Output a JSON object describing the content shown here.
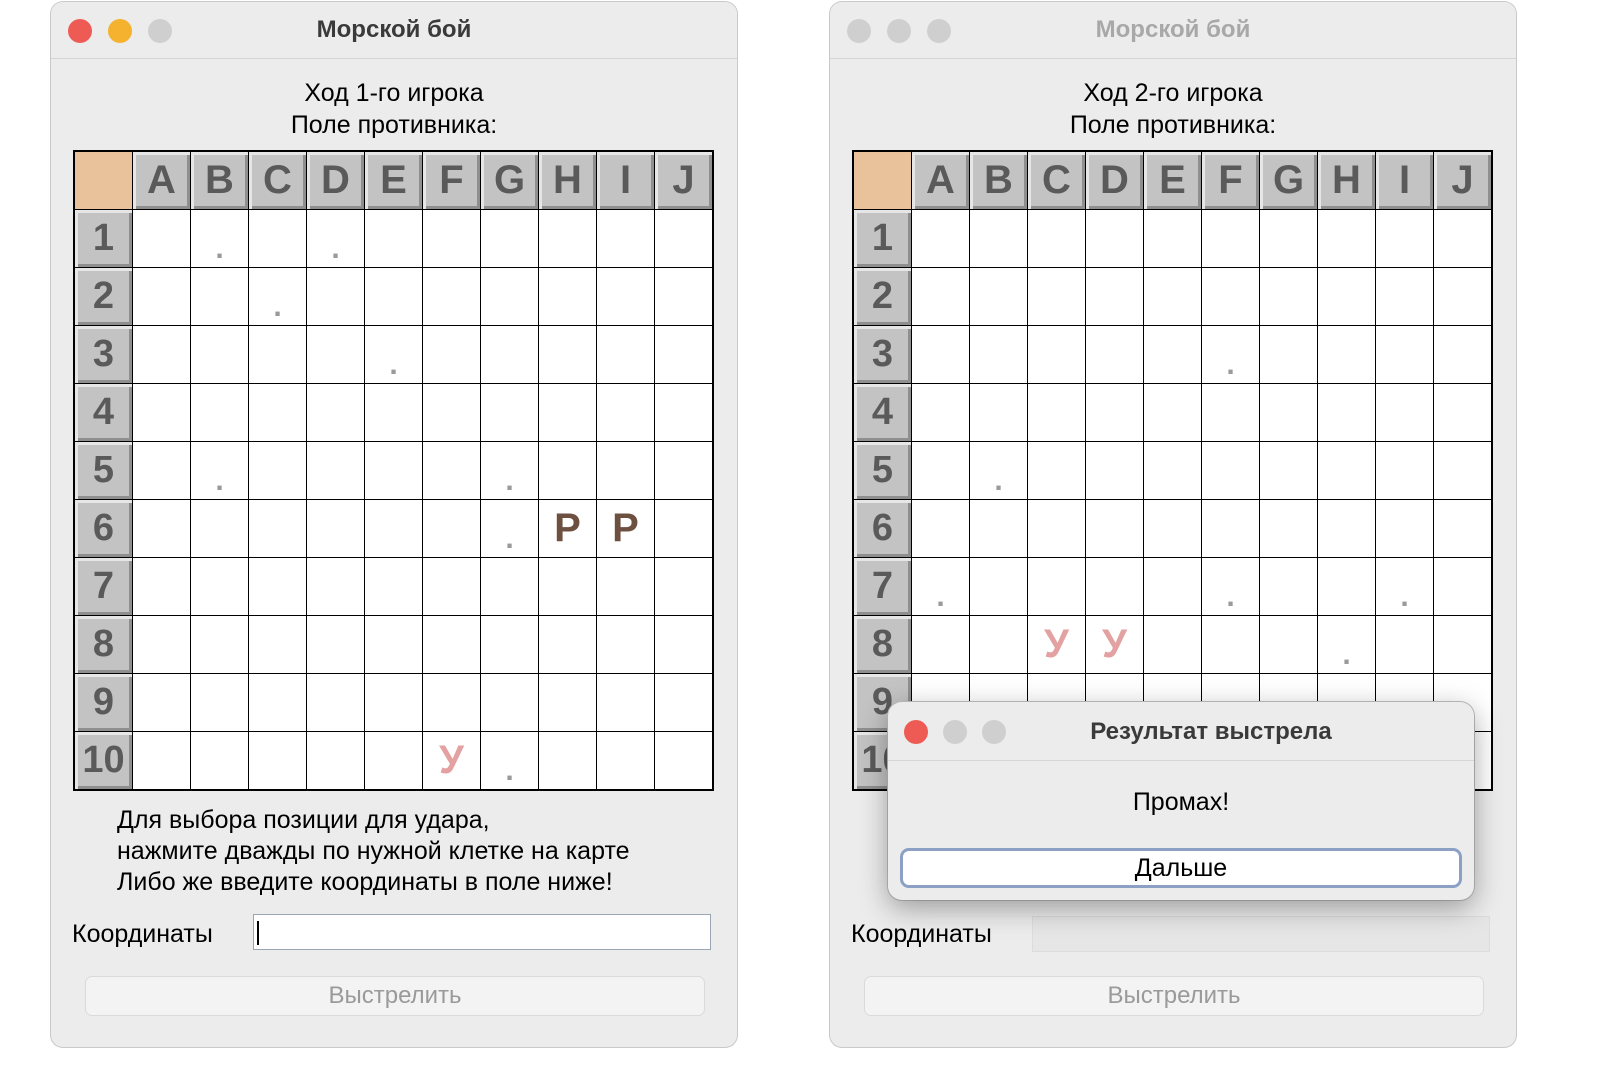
{
  "left_window": {
    "title": "Морской бой",
    "turn_text": "Ход 1-го игрока",
    "field_text": "Поле противника:",
    "columns": [
      "A",
      "B",
      "C",
      "D",
      "E",
      "F",
      "G",
      "H",
      "I",
      "J"
    ],
    "rows": [
      "1",
      "2",
      "3",
      "4",
      "5",
      "6",
      "7",
      "8",
      "9",
      "10"
    ],
    "marks": [
      {
        "row": "1",
        "col": "B",
        "kind": "miss",
        "symbol": "."
      },
      {
        "row": "1",
        "col": "D",
        "kind": "miss",
        "symbol": "."
      },
      {
        "row": "2",
        "col": "C",
        "kind": "miss",
        "symbol": "."
      },
      {
        "row": "3",
        "col": "E",
        "kind": "miss",
        "symbol": "."
      },
      {
        "row": "5",
        "col": "B",
        "kind": "miss",
        "symbol": "."
      },
      {
        "row": "5",
        "col": "G",
        "kind": "miss",
        "symbol": "."
      },
      {
        "row": "6",
        "col": "G",
        "kind": "miss",
        "symbol": "."
      },
      {
        "row": "6",
        "col": "H",
        "kind": "sunk",
        "symbol": "Р"
      },
      {
        "row": "6",
        "col": "I",
        "kind": "sunk",
        "symbol": "Р"
      },
      {
        "row": "10",
        "col": "F",
        "kind": "hit",
        "symbol": "У"
      },
      {
        "row": "10",
        "col": "G",
        "kind": "miss",
        "symbol": "."
      }
    ],
    "instructions": [
      "Для выбора позиции для удара,",
      "нажмите дважды по нужной клетке на карте",
      "Либо же введите координаты в поле ниже!"
    ],
    "coord_label": "Координаты",
    "coord_value": "",
    "fire_button": "Выстрелить"
  },
  "right_window": {
    "title": "Морской бой",
    "turn_text": "Ход 2-го игрока",
    "field_text": "Поле противника:",
    "columns": [
      "A",
      "B",
      "C",
      "D",
      "E",
      "F",
      "G",
      "H",
      "I",
      "J"
    ],
    "rows": [
      "1",
      "2",
      "3",
      "4",
      "5",
      "6",
      "7",
      "8",
      "9",
      "10"
    ],
    "marks": [
      {
        "row": "3",
        "col": "F",
        "kind": "miss",
        "symbol": "."
      },
      {
        "row": "5",
        "col": "B",
        "kind": "miss",
        "symbol": "."
      },
      {
        "row": "7",
        "col": "A",
        "kind": "miss",
        "symbol": "."
      },
      {
        "row": "7",
        "col": "F",
        "kind": "miss",
        "symbol": "."
      },
      {
        "row": "7",
        "col": "I",
        "kind": "miss",
        "symbol": "."
      },
      {
        "row": "8",
        "col": "C",
        "kind": "hit",
        "symbol": "У"
      },
      {
        "row": "8",
        "col": "D",
        "kind": "hit",
        "symbol": "У"
      },
      {
        "row": "8",
        "col": "H",
        "kind": "miss",
        "symbol": "."
      }
    ],
    "coord_label": "Координаты",
    "coord_value": "",
    "fire_button": "Выстрелить"
  },
  "dialog": {
    "title": "Результат выстрела",
    "message": "Промах!",
    "button": "Дальше"
  },
  "colors": {
    "corner": "#e9c29b",
    "header_cell": "#c3c3c3",
    "hit": "#e3a1a1",
    "sunk": "#6e5040",
    "miss": "#9a9a9a"
  }
}
